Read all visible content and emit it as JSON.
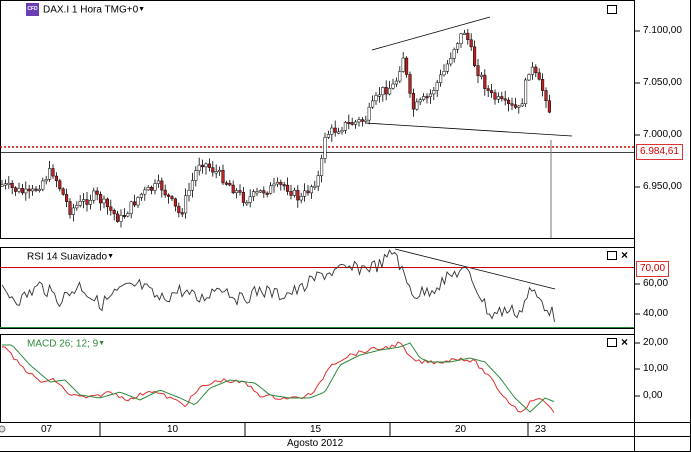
{
  "price_panel": {
    "title": "DAX.I 1 Hora TMG+0",
    "logo_text": "CFD",
    "y_labels": [
      "7.100,00",
      "7.050,00",
      "7.000,00",
      "6.950,00"
    ],
    "current_price": "6.984,61"
  },
  "rsi_panel": {
    "title": "RSI 14 Suavizado",
    "level_tag": "70,00",
    "y_labels": [
      "60,00",
      "40,00"
    ]
  },
  "macd_panel": {
    "title": "MACD 26; 12; 9",
    "y_labels": [
      "20,00",
      "10,00",
      "0,00"
    ]
  },
  "x_axis": {
    "day_labels": [
      "07",
      "10",
      "15",
      "20",
      "23"
    ],
    "month_label": "Agosto 2012"
  },
  "colors": {
    "bull_candle": "#ffffff",
    "bear_candle": "#c02020",
    "price_line": "#cc0000",
    "rsi_line": "#333333",
    "rsi_level": "#cc0000",
    "macd_line": "#2d8a3c",
    "signal_line": "#e03030"
  },
  "icons": {
    "dropdown": "caret-down-icon",
    "window": "restore-icon",
    "close": "close-icon"
  }
}
